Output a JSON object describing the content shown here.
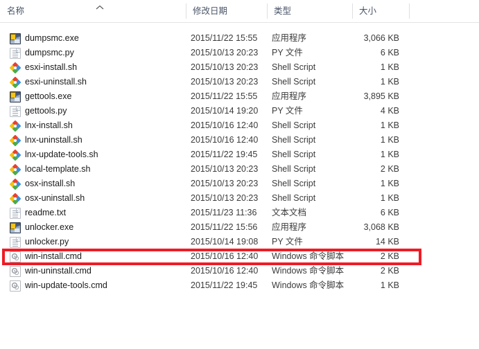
{
  "window": {
    "kind": "file-explorer-details-view"
  },
  "columns": {
    "name": "名称",
    "date_modified": "修改日期",
    "type": "类型",
    "size": "大小",
    "sort_indicator": "ʌ",
    "sorted_by": "名称",
    "sort_direction": "ascending"
  },
  "highlight": {
    "color": "#ee1c25",
    "target_row_index": 15,
    "target_file": "win-install.cmd"
  },
  "files": [
    {
      "name": "dumpsmc.exe",
      "date": "2015/11/22 15:55",
      "type": "应用程序",
      "size": "3,066 KB",
      "icon": "exe"
    },
    {
      "name": "dumpsmc.py",
      "date": "2015/10/13 20:23",
      "type": "PY 文件",
      "size": "6 KB",
      "icon": "doc"
    },
    {
      "name": "esxi-install.sh",
      "date": "2015/10/13 20:23",
      "type": "Shell Script",
      "size": "1 KB",
      "icon": "sh"
    },
    {
      "name": "esxi-uninstall.sh",
      "date": "2015/10/13 20:23",
      "type": "Shell Script",
      "size": "1 KB",
      "icon": "sh"
    },
    {
      "name": "gettools.exe",
      "date": "2015/11/22 15:55",
      "type": "应用程序",
      "size": "3,895 KB",
      "icon": "exe"
    },
    {
      "name": "gettools.py",
      "date": "2015/10/14 19:20",
      "type": "PY 文件",
      "size": "4 KB",
      "icon": "doc"
    },
    {
      "name": "lnx-install.sh",
      "date": "2015/10/16 12:40",
      "type": "Shell Script",
      "size": "1 KB",
      "icon": "sh"
    },
    {
      "name": "lnx-uninstall.sh",
      "date": "2015/10/16 12:40",
      "type": "Shell Script",
      "size": "1 KB",
      "icon": "sh"
    },
    {
      "name": "lnx-update-tools.sh",
      "date": "2015/11/22 19:45",
      "type": "Shell Script",
      "size": "1 KB",
      "icon": "sh"
    },
    {
      "name": "local-template.sh",
      "date": "2015/10/13 20:23",
      "type": "Shell Script",
      "size": "2 KB",
      "icon": "sh"
    },
    {
      "name": "osx-install.sh",
      "date": "2015/10/13 20:23",
      "type": "Shell Script",
      "size": "1 KB",
      "icon": "sh"
    },
    {
      "name": "osx-uninstall.sh",
      "date": "2015/10/13 20:23",
      "type": "Shell Script",
      "size": "1 KB",
      "icon": "sh"
    },
    {
      "name": "readme.txt",
      "date": "2015/11/23 11:36",
      "type": "文本文档",
      "size": "6 KB",
      "icon": "doc"
    },
    {
      "name": "unlocker.exe",
      "date": "2015/11/22 15:56",
      "type": "应用程序",
      "size": "3,068 KB",
      "icon": "exe"
    },
    {
      "name": "unlocker.py",
      "date": "2015/10/14 19:08",
      "type": "PY 文件",
      "size": "14 KB",
      "icon": "doc"
    },
    {
      "name": "win-install.cmd",
      "date": "2015/10/16 12:40",
      "type": "Windows 命令脚本",
      "size": "2 KB",
      "icon": "cmd"
    },
    {
      "name": "win-uninstall.cmd",
      "date": "2015/10/16 12:40",
      "type": "Windows 命令脚本",
      "size": "2 KB",
      "icon": "cmd"
    },
    {
      "name": "win-update-tools.cmd",
      "date": "2015/11/22 19:45",
      "type": "Windows 命令脚本",
      "size": "1 KB",
      "icon": "cmd"
    }
  ]
}
